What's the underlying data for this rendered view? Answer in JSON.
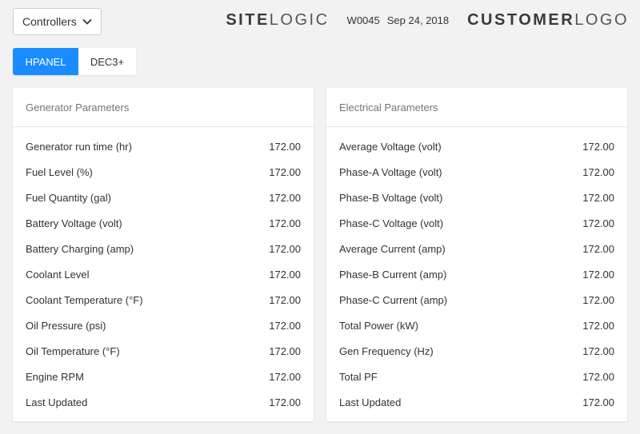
{
  "header": {
    "dropdown_value": "Controllers",
    "site_logo": {
      "bold": "SITE",
      "light": "LOGIC"
    },
    "site_id": "W0045",
    "date": "Sep 24, 2018",
    "customer_logo": {
      "bold": "CUSTOMER",
      "light": "LOGO"
    }
  },
  "tabs": [
    {
      "label": "HPANEL",
      "active": true
    },
    {
      "label": "DEC3+",
      "active": false
    }
  ],
  "colors": {
    "accent": "#1a8cff",
    "background": "#f2f2f2"
  },
  "generator": {
    "title": "Generator Parameters",
    "rows": [
      {
        "label": "Generator run time (hr)",
        "value": "172.00"
      },
      {
        "label": "Fuel Level (%)",
        "value": "172.00"
      },
      {
        "label": "Fuel Quantity (gal)",
        "value": "172.00"
      },
      {
        "label": "Battery Voltage (volt)",
        "value": "172.00"
      },
      {
        "label": "Battery Charging (amp)",
        "value": "172.00"
      },
      {
        "label": "Coolant Level",
        "value": "172.00"
      },
      {
        "label": "Coolant Temperature (°F)",
        "value": "172.00"
      },
      {
        "label": "Oil Pressure (psi)",
        "value": "172.00"
      },
      {
        "label": "Oil Temperature (°F)",
        "value": "172.00"
      },
      {
        "label": "Engine RPM",
        "value": "172.00"
      },
      {
        "label": "Last Updated",
        "value": "172.00"
      }
    ]
  },
  "electrical": {
    "title": "Electrical Parameters",
    "rows": [
      {
        "label": "Average Voltage (volt)",
        "value": "172.00"
      },
      {
        "label": "Phase-A Voltage (volt)",
        "value": "172.00"
      },
      {
        "label": "Phase-B Voltage (volt)",
        "value": "172.00"
      },
      {
        "label": "Phase-C Voltage (volt)",
        "value": "172.00"
      },
      {
        "label": "Average Current (amp)",
        "value": "172.00"
      },
      {
        "label": "Phase-B Current (amp)",
        "value": "172.00"
      },
      {
        "label": "Phase-C Current (amp)",
        "value": "172.00"
      },
      {
        "label": "Total Power (kW)",
        "value": "172.00"
      },
      {
        "label": "Gen Frequency (Hz)",
        "value": "172.00"
      },
      {
        "label": "Total PF",
        "value": "172.00"
      },
      {
        "label": "Last Updated",
        "value": "172.00"
      }
    ]
  }
}
